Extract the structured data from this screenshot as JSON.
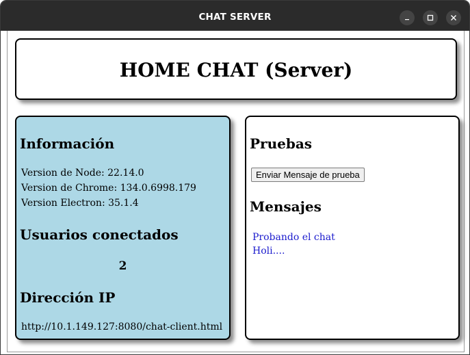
{
  "window": {
    "title": "CHAT SERVER",
    "controls": {
      "minimize_icon": "minimize-icon",
      "maximize_icon": "maximize-icon",
      "close_icon": "close-icon"
    }
  },
  "header": {
    "title": "HOME CHAT (Server)"
  },
  "info_panel": {
    "heading": "Información",
    "lines": [
      "Version de Node: 22.14.0",
      "Version de Chrome: 134.0.6998.179",
      "Version Electron: 35.1.4"
    ],
    "users_heading": "Usuarios conectados",
    "users_count": "2",
    "ip_heading": "Dirección IP",
    "ip_value": "http://10.1.149.127:8080/chat-client.html",
    "background_color": "#add8e6"
  },
  "tests_panel": {
    "heading": "Pruebas",
    "button_label": "Enviar Mensaje de prueba",
    "messages_heading": "Mensajes",
    "messages": [
      "Probando el chat",
      "Holi...."
    ],
    "message_color": "#1a1acd"
  }
}
